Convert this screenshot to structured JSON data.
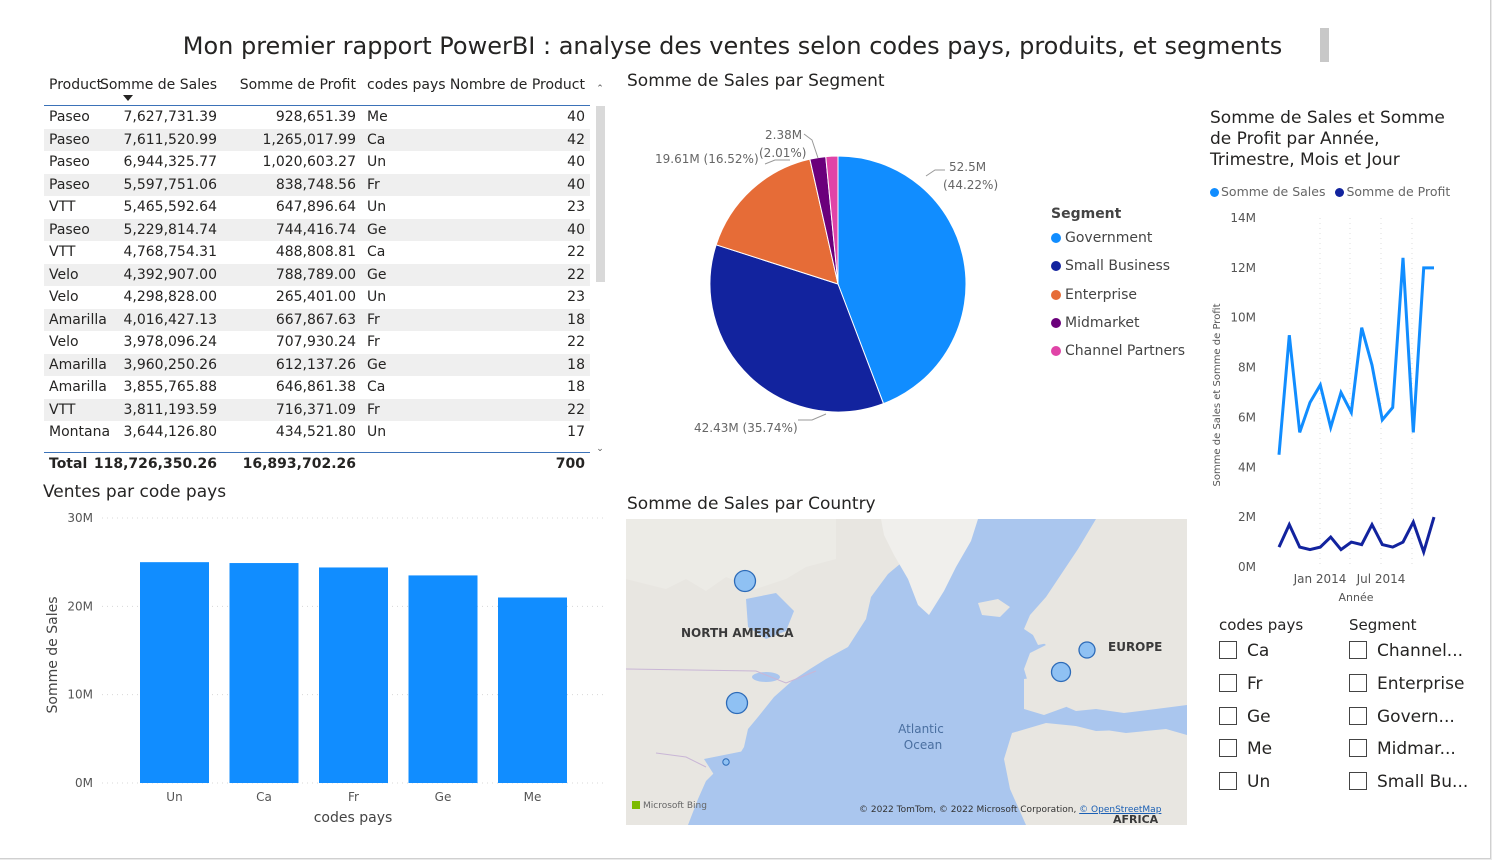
{
  "report_title": "Mon premier rapport PowerBI : analyse des ventes selon codes pays, produits, et segments",
  "table": {
    "columns": [
      "Product",
      "Somme de Sales",
      "Somme de Profit",
      "codes pays",
      "Nombre de Product"
    ],
    "sort_icon": "sort-descending-icon",
    "rows": [
      [
        "Paseo",
        "7,627,731.39",
        "928,651.39",
        "Me",
        "40"
      ],
      [
        "Paseo",
        "7,611,520.99",
        "1,265,017.99",
        "Ca",
        "42"
      ],
      [
        "Paseo",
        "6,944,325.77",
        "1,020,603.27",
        "Un",
        "40"
      ],
      [
        "Paseo",
        "5,597,751.06",
        "838,748.56",
        "Fr",
        "40"
      ],
      [
        "VTT",
        "5,465,592.64",
        "647,896.64",
        "Un",
        "23"
      ],
      [
        "Paseo",
        "5,229,814.74",
        "744,416.74",
        "Ge",
        "40"
      ],
      [
        "VTT",
        "4,768,754.31",
        "488,808.81",
        "Ca",
        "22"
      ],
      [
        "Velo",
        "4,392,907.00",
        "788,789.00",
        "Ge",
        "22"
      ],
      [
        "Velo",
        "4,298,828.00",
        "265,401.00",
        "Un",
        "23"
      ],
      [
        "Amarilla",
        "4,016,427.13",
        "667,867.63",
        "Fr",
        "18"
      ],
      [
        "Velo",
        "3,978,096.24",
        "707,930.24",
        "Fr",
        "22"
      ],
      [
        "Amarilla",
        "3,960,250.26",
        "612,137.26",
        "Ge",
        "18"
      ],
      [
        "Amarilla",
        "3,855,765.88",
        "646,861.38",
        "Ca",
        "18"
      ],
      [
        "VTT",
        "3,811,193.59",
        "716,371.09",
        "Fr",
        "22"
      ],
      [
        "Montana",
        "3,644,126.80",
        "434,521.80",
        "Un",
        "17"
      ]
    ],
    "total": [
      "Total",
      "118,726,350.26",
      "16,893,702.26",
      "",
      "700"
    ]
  },
  "pie": {
    "title": "Somme de Sales par Segment",
    "legend_title": "Segment",
    "labels": {
      "government": [
        "52.5M",
        "(44.22%)"
      ],
      "small_business": [
        "42.43M (35.74%)"
      ],
      "enterprise": [
        "19.61M (16.52%)"
      ],
      "midmarket": [
        "2.38M",
        "(2.01%)"
      ]
    }
  },
  "bar": {
    "title": "Ventes par code pays",
    "xlabel": "codes pays",
    "ylabel": "Somme de Sales",
    "yticks": [
      "30M",
      "20M",
      "10M",
      "0M"
    ]
  },
  "line": {
    "title_lines": [
      "Somme de Sales et Somme",
      "de Profit par Année,",
      "Trimestre, Mois et Jour"
    ],
    "legend": [
      "Somme de  Sales",
      "Somme de Profit"
    ],
    "ylabel": "Somme de Sales et Somme de Profit",
    "xlabel": "Année",
    "yticks": [
      "14M",
      "12M",
      "10M",
      "8M",
      "6M",
      "4M",
      "2M",
      "0M"
    ],
    "xticks": [
      "Jan 2014",
      "Jul 2014"
    ]
  },
  "map": {
    "title": "Somme de Sales par Country",
    "labels": {
      "north_america": "NORTH AMERICA",
      "europe": "EUROPE",
      "ocean1": "Atlantic",
      "ocean2": "Ocean",
      "africa": "AFRICA"
    },
    "bing": "Microsoft Bing",
    "attribution": "© 2022 TomTom, © 2022 Microsoft Corporation, ",
    "osm": "© OpenStreetMap"
  },
  "slicers": {
    "codes": {
      "title": "codes pays",
      "items": [
        "Ca",
        "Fr",
        "Ge",
        "Me",
        "Un"
      ]
    },
    "segment": {
      "title": "Segment",
      "items": [
        "Channel...",
        "Enterprise",
        "Govern...",
        "Midmar...",
        "Small Bu..."
      ]
    }
  },
  "colors": {
    "government": "#118DFF",
    "small_business": "#12239E",
    "enterprise": "#E66C37",
    "midmarket": "#6B007B",
    "channel_partners": "#E044A7",
    "bar": "#118DFF"
  },
  "chart_data": [
    {
      "type": "pie",
      "title": "Somme de Sales par Segment",
      "categories": [
        "Government",
        "Small Business",
        "Enterprise",
        "Midmarket",
        "Channel Partners"
      ],
      "values": [
        52.5,
        42.43,
        19.61,
        2.38,
        1.81
      ],
      "unit": "M",
      "legend_position": "right"
    },
    {
      "type": "bar",
      "title": "Ventes par code pays",
      "xlabel": "codes pays",
      "ylabel": "Somme de Sales",
      "categories": [
        "Un",
        "Ca",
        "Fr",
        "Ge",
        "Me"
      ],
      "values": [
        25.0,
        24.9,
        24.4,
        23.5,
        21.0
      ],
      "unit": "M",
      "ylim": [
        0,
        30
      ]
    },
    {
      "type": "line",
      "title": "Somme de Sales et Somme de Profit par Année, Trimestre, Mois et Jour",
      "xlabel": "Année",
      "ylabel": "Somme de Sales et Somme de Profit",
      "x": [
        "2013-09",
        "2013-10",
        "2013-11",
        "2013-12",
        "2014-01",
        "2014-02",
        "2014-03",
        "2014-04",
        "2014-05",
        "2014-06",
        "2014-07",
        "2014-08",
        "2014-09",
        "2014-10",
        "2014-11",
        "2014-12"
      ],
      "series": [
        {
          "name": "Somme de  Sales",
          "values": [
            4.5,
            9.3,
            5.4,
            6.6,
            7.3,
            5.6,
            7.0,
            6.2,
            9.6,
            8.1,
            5.9,
            6.4,
            12.4,
            5.4,
            12.0,
            12.0
          ]
        },
        {
          "name": "Somme de Profit",
          "values": [
            0.8,
            1.7,
            0.8,
            0.7,
            0.8,
            1.2,
            0.7,
            1.0,
            0.9,
            1.7,
            0.9,
            0.8,
            1.0,
            1.8,
            0.6,
            2.0
          ]
        }
      ],
      "ylim": [
        0,
        14
      ],
      "legend_position": "top"
    }
  ]
}
